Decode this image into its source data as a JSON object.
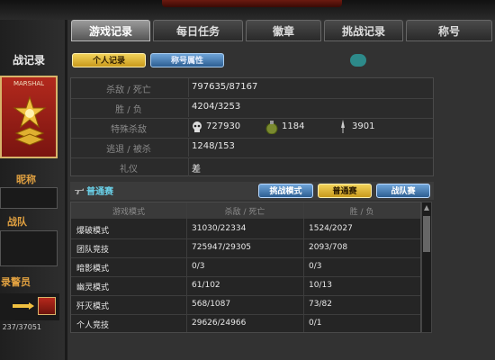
{
  "left": {
    "title": "战记录",
    "rank_name": "MARSHAL",
    "nickname_label": "昵称",
    "team_label": "战队",
    "record_label": "录警员",
    "record_value": "237/37051"
  },
  "tabs": [
    {
      "label": "游戏记录",
      "active": true
    },
    {
      "label": "每日任务",
      "active": false
    },
    {
      "label": "徽章",
      "active": false
    },
    {
      "label": "挑战记录",
      "active": false
    },
    {
      "label": "称号",
      "active": false
    }
  ],
  "subtabs": {
    "personal": "个人记录",
    "title_attr": "称号属性"
  },
  "stats": {
    "kd": {
      "label": "杀敌 / 死亡",
      "value": "797635/87167"
    },
    "wl": {
      "label": "胜 / 负",
      "value": "4204/3253"
    },
    "special": {
      "label": "特殊杀敌",
      "headshot": "727930",
      "grenade": "1184",
      "knife": "3901"
    },
    "escape": {
      "label": "逃退 / 被杀",
      "value": "1248/153"
    },
    "manner": {
      "label": "礼仪",
      "value": "差"
    }
  },
  "modes": {
    "title": "普通赛",
    "btn_challenge": "挑战模式",
    "btn_normal": "普通赛",
    "btn_clan": "战队赛",
    "headers": [
      "游戏模式",
      "杀敌 / 死亡",
      "胜 / 负"
    ],
    "rows": [
      [
        "爆破模式",
        "31030/22334",
        "1524/2027"
      ],
      [
        "团队竞技",
        "725947/29305",
        "2093/708"
      ],
      [
        "暗影模式",
        "0/3",
        "0/3"
      ],
      [
        "幽灵模式",
        "61/102",
        "10/13"
      ],
      [
        "歼灭模式",
        "568/1087",
        "73/82"
      ],
      [
        "个人竞技",
        "29626/24966",
        "0/1"
      ]
    ]
  },
  "colors": {
    "accent_gold": "#f2d35a",
    "accent_blue": "#2d5f93",
    "rank_red": "#b2291d"
  }
}
